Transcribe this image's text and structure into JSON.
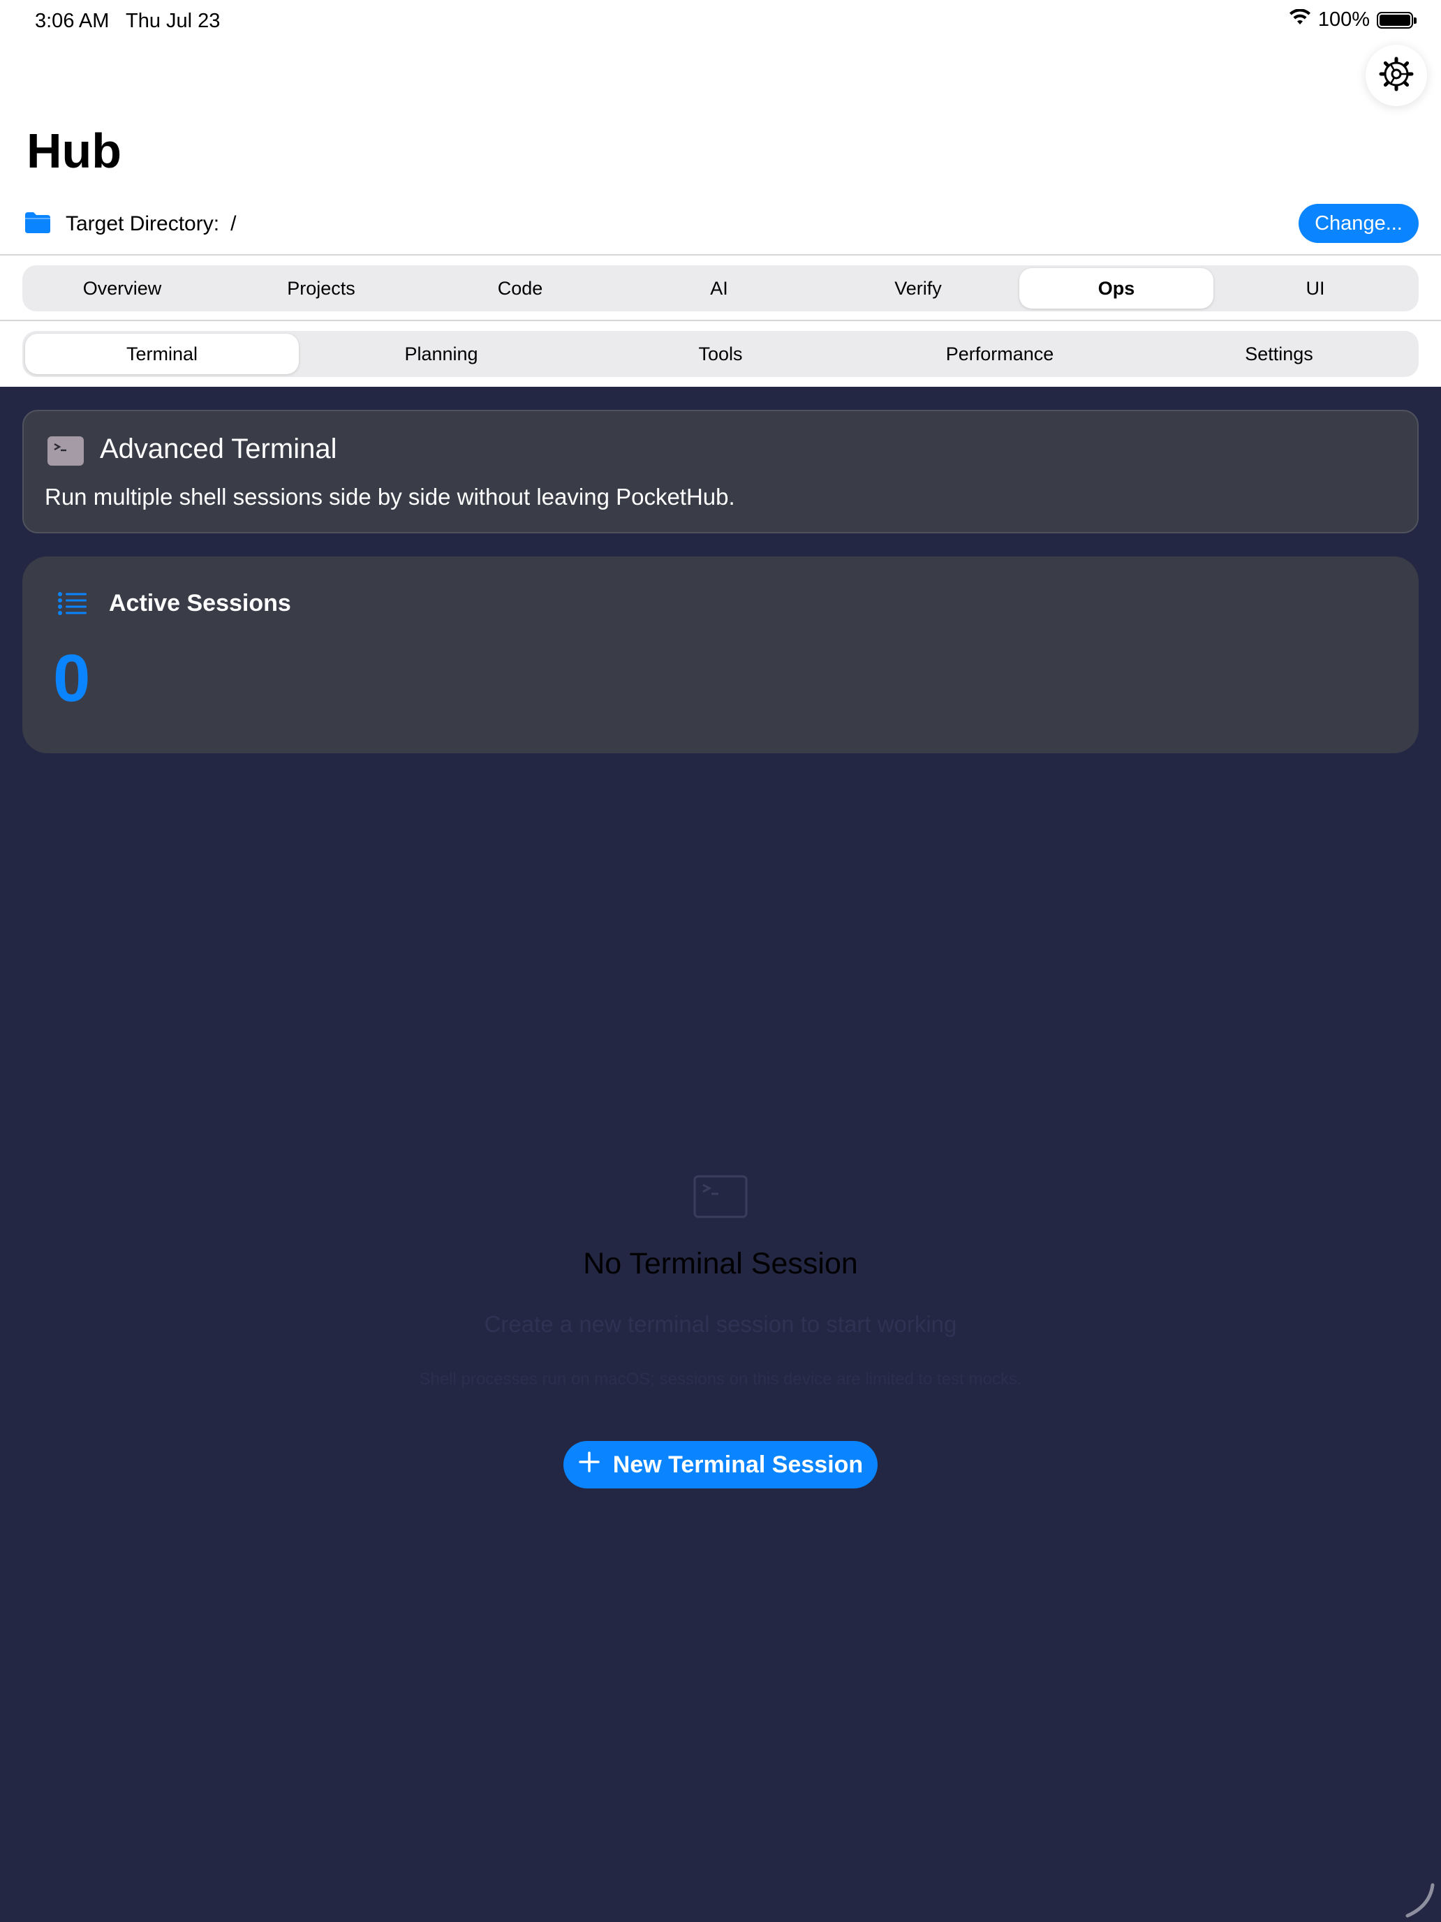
{
  "status_bar": {
    "time": "3:06 AM",
    "date": "Thu Jul 23",
    "battery": "100%",
    "wifi_icon": "wifi-icon",
    "battery_icon": "battery-icon"
  },
  "header": {
    "title": "Hub",
    "settings_icon": "gear-icon"
  },
  "target_directory": {
    "icon": "folder-icon",
    "label": "Target Directory:",
    "value": "/",
    "change_button": "Change..."
  },
  "top_tabs": {
    "items": [
      "Overview",
      "Projects",
      "Code",
      "AI",
      "Verify",
      "Ops",
      "UI"
    ],
    "selected": "Ops"
  },
  "sub_tabs": {
    "items": [
      "Terminal",
      "Planning",
      "Tools",
      "Performance",
      "Settings"
    ],
    "selected": "Terminal"
  },
  "advanced_terminal": {
    "icon": "terminal-icon",
    "title": "Advanced Terminal",
    "description": "Run multiple shell sessions side by side without leaving PocketHub."
  },
  "active_sessions": {
    "icon": "list-icon",
    "title": "Active Sessions",
    "count": "0"
  },
  "empty_state": {
    "icon": "terminal-icon",
    "title": "No Terminal Session",
    "subtitle": "Create a new terminal session to start working",
    "note": "Shell processes run on macOS; sessions on this device are limited to test mocks.",
    "button_label": "New Terminal Session",
    "button_icon": "plus-icon"
  },
  "colors": {
    "accent": "#0a84ff",
    "background_dark": "#242744",
    "card": "#3a3d47"
  }
}
